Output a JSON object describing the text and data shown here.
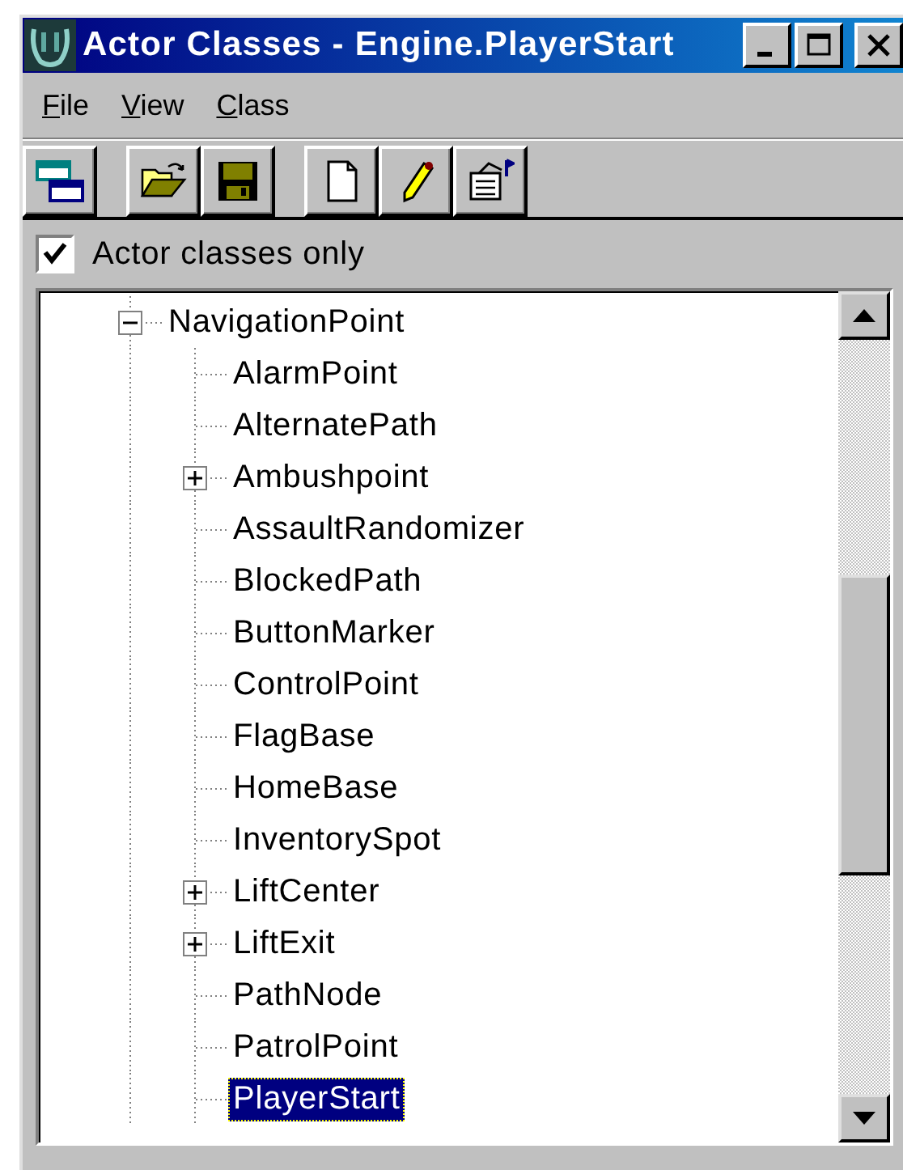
{
  "window": {
    "title": "Actor Classes - Engine.PlayerStart"
  },
  "menu": [
    {
      "label": "File"
    },
    {
      "label": "View"
    },
    {
      "label": "Class"
    }
  ],
  "filter": {
    "label": "Actor classes only",
    "checked": true
  },
  "tree": [
    {
      "label": "NavigationPoint",
      "expandable": true,
      "expanded": true,
      "selected": false,
      "children": [
        {
          "label": "AlarmPoint",
          "expandable": false,
          "selected": false
        },
        {
          "label": "AlternatePath",
          "expandable": false,
          "selected": false
        },
        {
          "label": "Ambushpoint",
          "expandable": true,
          "expanded": false,
          "selected": false
        },
        {
          "label": "AssaultRandomizer",
          "expandable": false,
          "selected": false
        },
        {
          "label": "BlockedPath",
          "expandable": false,
          "selected": false
        },
        {
          "label": "ButtonMarker",
          "expandable": false,
          "selected": false
        },
        {
          "label": "ControlPoint",
          "expandable": false,
          "selected": false
        },
        {
          "label": "FlagBase",
          "expandable": false,
          "selected": false
        },
        {
          "label": "HomeBase",
          "expandable": false,
          "selected": false
        },
        {
          "label": "InventorySpot",
          "expandable": false,
          "selected": false
        },
        {
          "label": "LiftCenter",
          "expandable": true,
          "expanded": false,
          "selected": false
        },
        {
          "label": "LiftExit",
          "expandable": true,
          "expanded": false,
          "selected": false
        },
        {
          "label": "PathNode",
          "expandable": false,
          "selected": false
        },
        {
          "label": "PatrolPoint",
          "expandable": false,
          "selected": false
        },
        {
          "label": "PlayerStart",
          "expandable": false,
          "selected": true
        }
      ]
    }
  ]
}
